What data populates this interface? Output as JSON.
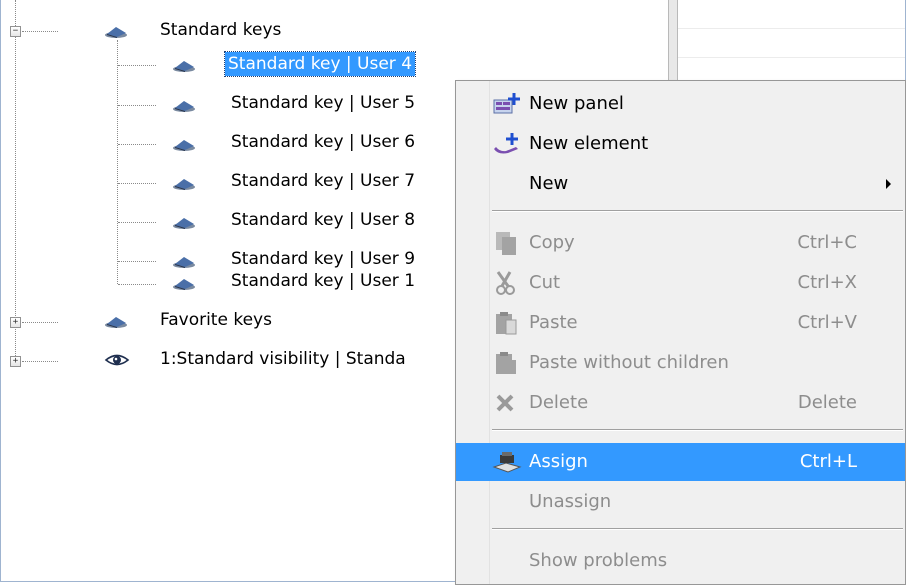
{
  "tree": {
    "nodes": [
      {
        "label": "Standard keys",
        "icon": "key-group-icon",
        "expander": "−",
        "selected": false
      },
      {
        "label": "Standard key | User 4",
        "icon": "key-icon",
        "selected": true
      },
      {
        "label": "Standard key | User 5",
        "icon": "key-icon",
        "selected": false
      },
      {
        "label": "Standard key | User 6",
        "icon": "key-icon",
        "selected": false
      },
      {
        "label": "Standard key | User 7",
        "icon": "key-icon",
        "selected": false
      },
      {
        "label": "Standard key | User 8",
        "icon": "key-icon",
        "selected": false
      },
      {
        "label": "Standard key | User 9",
        "icon": "key-icon",
        "selected": false
      },
      {
        "label": "Standard key | User 1",
        "icon": "key-icon",
        "selected": false
      },
      {
        "label": "Favorite keys",
        "icon": "key-group-icon",
        "expander": "+",
        "selected": false
      },
      {
        "label": "1:Standard visibility | Standa",
        "icon": "eye-icon",
        "expander": "+",
        "selected": false
      }
    ]
  },
  "context_menu": {
    "items": [
      {
        "label": "New panel",
        "shortcut": "",
        "icon": "new-panel-icon",
        "enabled": true
      },
      {
        "label": "New element",
        "shortcut": "",
        "icon": "new-element-icon",
        "enabled": true
      },
      {
        "label": "New",
        "shortcut": "",
        "icon": "",
        "enabled": true,
        "submenu": true
      },
      {
        "label": "Copy",
        "shortcut": "Ctrl+C",
        "icon": "copy-icon",
        "enabled": false
      },
      {
        "label": "Cut",
        "shortcut": "Ctrl+X",
        "icon": "cut-icon",
        "enabled": false
      },
      {
        "label": "Paste",
        "shortcut": "Ctrl+V",
        "icon": "paste-icon",
        "enabled": false
      },
      {
        "label": "Paste without children",
        "shortcut": "",
        "icon": "paste-without-children-icon",
        "enabled": false
      },
      {
        "label": "Delete",
        "shortcut": "Delete",
        "icon": "delete-icon",
        "enabled": false
      },
      {
        "label": "Assign",
        "shortcut": "Ctrl+L",
        "icon": "assign-icon",
        "enabled": true,
        "highlighted": true
      },
      {
        "label": "Unassign",
        "shortcut": "",
        "icon": "",
        "enabled": false
      },
      {
        "label": "Show problems",
        "shortcut": "",
        "icon": "",
        "enabled": false
      }
    ]
  },
  "colors": {
    "selection": "#3399ff",
    "menu_background": "#f0f0f0",
    "disabled_text": "#8d8d8d"
  }
}
